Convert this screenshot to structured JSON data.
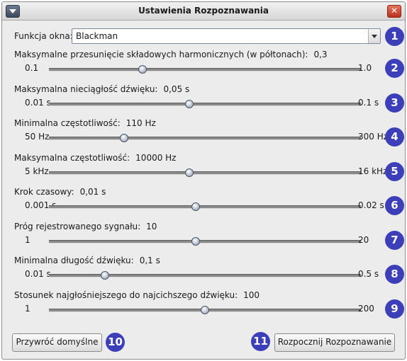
{
  "window": {
    "title": "Ustawienia Rozpoznawania",
    "close_label": "✕"
  },
  "window_function": {
    "label": "Funkcja okna:",
    "value": "Blackman",
    "badge": "1"
  },
  "sliders": [
    {
      "label": "Maksymalne przesunięcie składowych harmonicznych (w półtonach):",
      "value": "0,3",
      "min": "0.1",
      "max": "1.0",
      "position": 0.3,
      "badge": "2"
    },
    {
      "label": "Maksymalna nieciągłość dźwięku:",
      "value": "0,05 s",
      "min": "0.01 s",
      "max": "0.1 s",
      "position": 0.45,
      "badge": "3"
    },
    {
      "label": "Minimalna częstotliwość:",
      "value": "110 Hz",
      "min": "50 Hz",
      "max": "300 Hz",
      "position": 0.24,
      "badge": "4"
    },
    {
      "label": "Maksymalna częstotliwość:",
      "value": "10000 Hz",
      "min": "5 kHz",
      "max": "16 kHz",
      "position": 0.45,
      "badge": "5"
    },
    {
      "label": "Krok czasowy:",
      "value": "0,01 s",
      "min": "0.001 s",
      "max": "0.02 s",
      "position": 0.47,
      "badge": "6"
    },
    {
      "label": "Próg rejestrowanego sygnału:",
      "value": "10",
      "min": "1",
      "max": "20",
      "position": 0.47,
      "badge": "7"
    },
    {
      "label": "Minimalna długość dźwięku:",
      "value": "0,1 s",
      "min": "0.01 s",
      "max": "0.5 s",
      "position": 0.18,
      "badge": "8"
    },
    {
      "label": "Stosunek najgłośniejszego do najcichszego dźwięku:",
      "value": "100",
      "min": "1",
      "max": "200",
      "position": 0.5,
      "badge": "9"
    }
  ],
  "buttons": {
    "reset_label": "Przywróć domyślne",
    "reset_badge": "10",
    "start_label": "Rozpocznij Rozpoznawanie",
    "start_badge": "11"
  }
}
